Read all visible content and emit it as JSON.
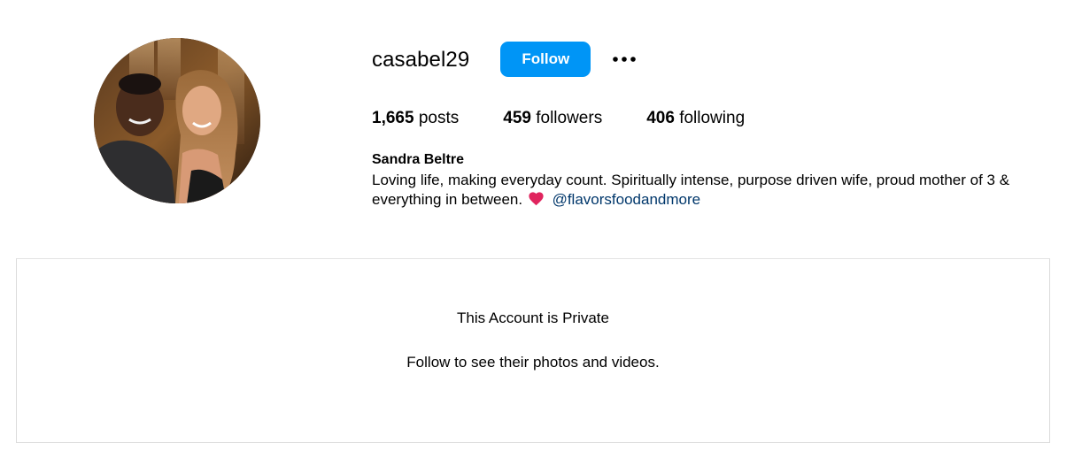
{
  "profile": {
    "username": "casabel29",
    "follow_label": "Follow",
    "more_icon": "more-horizontal-icon",
    "avatar_icon": "profile-avatar-photo",
    "stats": {
      "posts_count": "1,665",
      "posts_label": "posts",
      "followers_count": "459",
      "followers_label": "followers",
      "following_count": "406",
      "following_label": "following"
    },
    "full_name": "Sandra Beltre",
    "bio_text": "Loving life, making everyday count. Spiritually intense, purpose driven wife, proud mother of 3 & everything in between.",
    "bio_emoji": "heart-icon",
    "bio_mention": "@flavorsfoodandmore"
  },
  "private_notice": {
    "title": "This Account is Private",
    "subtitle": "Follow to see their photos and videos."
  },
  "colors": {
    "accent": "#0095f6",
    "mention": "#00376b",
    "heart": "#e0245e",
    "border": "#dbdbdb"
  }
}
